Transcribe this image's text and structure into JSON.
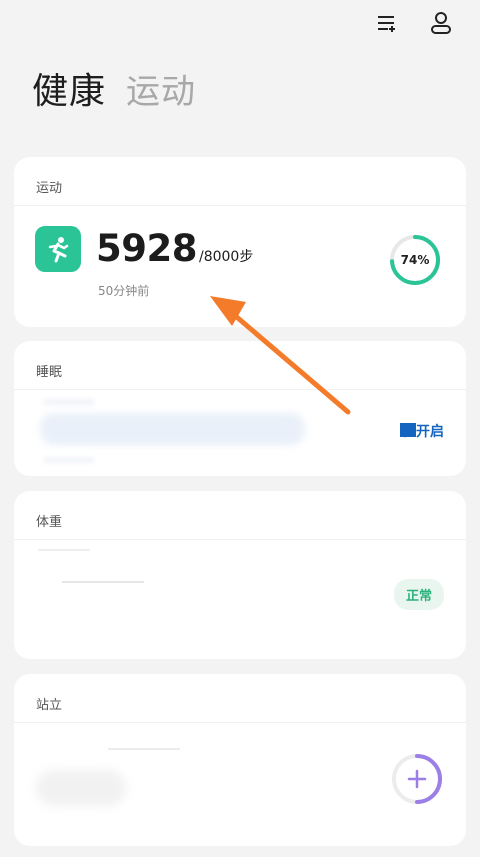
{
  "header": {
    "tab_health": "健康",
    "tab_exercise": "运动",
    "list_icon": "list-add-icon",
    "profile_icon": "profile-icon"
  },
  "exercise_card": {
    "title": "运动",
    "icon": "running-person-icon",
    "steps": "5928",
    "goal": "/8000步",
    "updated": "50分钟前",
    "progress_label": "74%",
    "progress_fraction": 0.74,
    "accent_color": "#2ac497"
  },
  "sleep_card": {
    "title": "睡眠",
    "link_label": "往开启",
    "link_color": "#1565c0"
  },
  "weight_card": {
    "title": "体重",
    "status_badge": "正常",
    "badge_color": "#2ab27b"
  },
  "stand_card": {
    "title": "站立",
    "add_icon": "plus-icon",
    "ring_color": "#9b7fe6"
  },
  "annotation": {
    "arrow_color": "#f47b2a"
  }
}
